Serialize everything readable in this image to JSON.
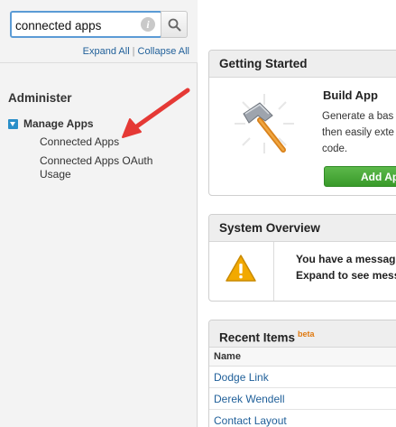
{
  "sidebar": {
    "search": {
      "value": "connected apps"
    },
    "expand_all": "Expand All",
    "separator": "|",
    "collapse_all": "Collapse All",
    "section_title": "Administer",
    "group": {
      "label": "Manage Apps",
      "items": [
        {
          "label": "Connected Apps"
        },
        {
          "label": "Connected Apps OAuth Usage"
        }
      ]
    }
  },
  "panels": {
    "getting_started": {
      "title": "Getting Started",
      "build_title": "Build App",
      "desc_line1": "Generate a bas",
      "desc_line2": "then easily exte",
      "desc_line3": "code.",
      "button": "Add Ap"
    },
    "system_overview": {
      "title": "System Overview",
      "msg_line1": "You have a messag",
      "msg_line2": "Expand to see mess"
    },
    "recent_items": {
      "title": "Recent Items",
      "badge": "beta",
      "column": "Name",
      "rows": [
        {
          "name": "Dodge Link"
        },
        {
          "name": "Derek Wendell"
        },
        {
          "name": "Contact Layout"
        }
      ]
    }
  },
  "icons": {
    "search": "search-icon",
    "info": "info-icon",
    "toggle": "collapse-toggle-icon",
    "hammer": "hammer-icon",
    "warning": "warning-icon",
    "annotation": "red-arrow-annotation"
  },
  "colors": {
    "search_focus_border": "#5b9bd5",
    "link": "#1f5f99",
    "toggle": "#2a8fc9",
    "add_button": "#399a2a",
    "warning": "#f2a900",
    "annotation_arrow": "#e53935",
    "beta": "#e07a10"
  }
}
